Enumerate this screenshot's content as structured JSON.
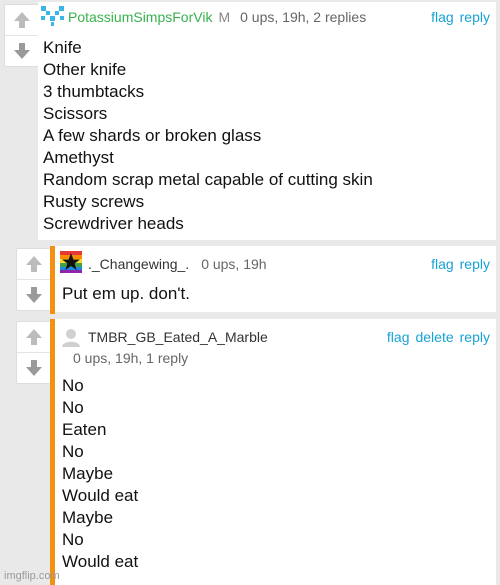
{
  "comments": [
    {
      "username": "PotassiumSimpsForVik",
      "mod_badge": "M",
      "meta": "0 ups, 19h, 2 replies",
      "actions": [
        "flag",
        "reply"
      ],
      "lines": [
        "Knife",
        "Other knife",
        "3 thumbtacks",
        "Scissors",
        "A few shards or broken glass",
        "Amethyst",
        "Random scrap metal capable of cutting skin",
        "Rusty screws",
        "Screwdriver heads"
      ]
    },
    {
      "username": "._Changewing_.",
      "meta": "0 ups, 19h",
      "actions": [
        "flag",
        "reply"
      ],
      "lines": [
        "Put em up. don't."
      ]
    },
    {
      "username": "TMBR_GB_Eated_A_Marble",
      "meta": "0 ups, 19h, 1 reply",
      "actions": [
        "flag",
        "delete",
        "reply"
      ],
      "lines": [
        "No",
        "No",
        "Eaten",
        "No",
        "Maybe",
        "Would eat",
        "Maybe",
        "No",
        "Would eat"
      ]
    }
  ],
  "watermark": "imgflip.com",
  "colors": {
    "accent_bar": "#f29112",
    "link": "#17a2d6",
    "username_green": "#37b24d"
  }
}
